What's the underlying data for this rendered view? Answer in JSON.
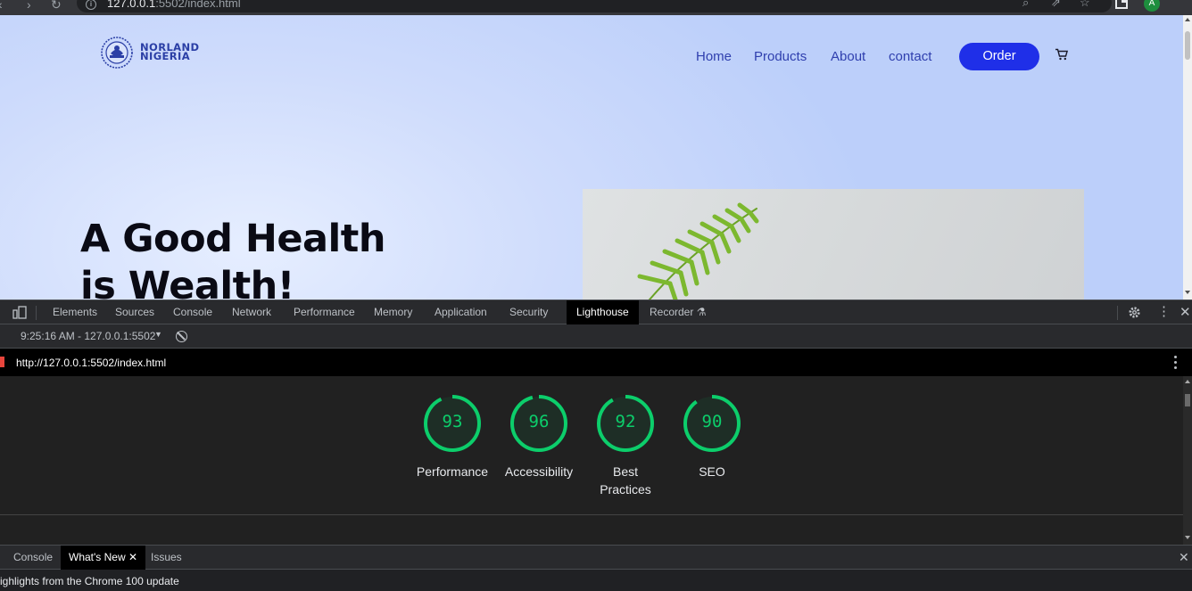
{
  "browser": {
    "url_host": "127.0.0.1",
    "url_rest": ":5502/index.html",
    "profile_initial": "A"
  },
  "site": {
    "logo": {
      "line1": "NORLAND",
      "line2": "NIGERIA"
    },
    "nav": [
      {
        "label": "Home"
      },
      {
        "label": "Products"
      },
      {
        "label": "About"
      },
      {
        "label": "contact"
      }
    ],
    "order_label": "Order",
    "hero": {
      "line1": "A Good Health",
      "line2": "is Wealth!"
    },
    "colors": {
      "nav": "#2f3fae",
      "order_bg": "#1f2fe8",
      "hero_text": "#0a0a14"
    }
  },
  "devtools": {
    "tabs": [
      "Elements",
      "Sources",
      "Console",
      "Network",
      "Performance",
      "Memory",
      "Application",
      "Security",
      "Lighthouse",
      "Recorder"
    ],
    "active_tab": "Lighthouse",
    "session": "9:25:16 AM - 127.0.0.1:5502",
    "report_url": "http://127.0.0.1:5502/index.html",
    "scores": [
      {
        "label": "Performance",
        "value": 93
      },
      {
        "label": "Accessibility",
        "value": 96
      },
      {
        "label": "Best Practices",
        "label_l1": "Best",
        "label_l2": "Practices",
        "value": 92
      },
      {
        "label": "SEO",
        "value": 90
      }
    ],
    "score_color": "#0cce6b",
    "drawer_tabs": [
      "Console",
      "What's New",
      "Issues"
    ],
    "drawer_active": "What's New",
    "drawer_note": "ighlights from the Chrome 100 update"
  }
}
